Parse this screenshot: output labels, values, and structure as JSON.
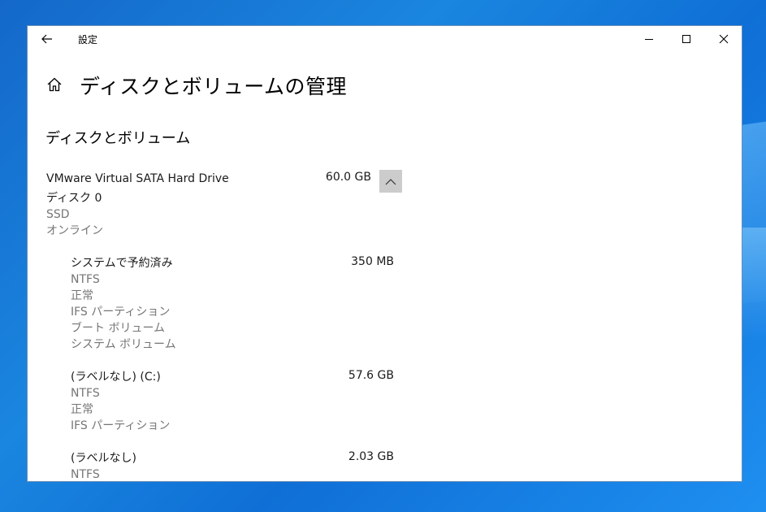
{
  "window": {
    "title": "設定"
  },
  "page": {
    "title": "ディスクとボリュームの管理"
  },
  "section": {
    "title": "ディスクとボリューム"
  },
  "disk": {
    "name": "VMware Virtual SATA Hard Drive",
    "size": "60.0 GB",
    "id": "ディスク 0",
    "type": "SSD",
    "status": "オンライン"
  },
  "volumes": [
    {
      "name": "システムで予約済み",
      "size": "350 MB",
      "details": [
        "NTFS",
        "正常",
        "IFS パーティション",
        "ブート ボリューム",
        "システム ボリューム"
      ]
    },
    {
      "name": "(ラベルなし) (C:)",
      "size": "57.6 GB",
      "details": [
        "NTFS",
        "正常",
        "IFS パーティション"
      ]
    },
    {
      "name": "(ラベルなし)",
      "size": "2.03 GB",
      "details": [
        "NTFS"
      ]
    }
  ],
  "icons": {
    "back": "back-arrow-icon",
    "minimize": "minimize-icon",
    "maximize": "maximize-icon",
    "close": "close-icon",
    "home": "home-icon",
    "collapse": "chevron-up-icon"
  },
  "colors": {
    "desktop": "#1a86df",
    "window_bg": "#ffffff",
    "text_secondary": "#757575",
    "button_pressed": "#cccccc"
  }
}
